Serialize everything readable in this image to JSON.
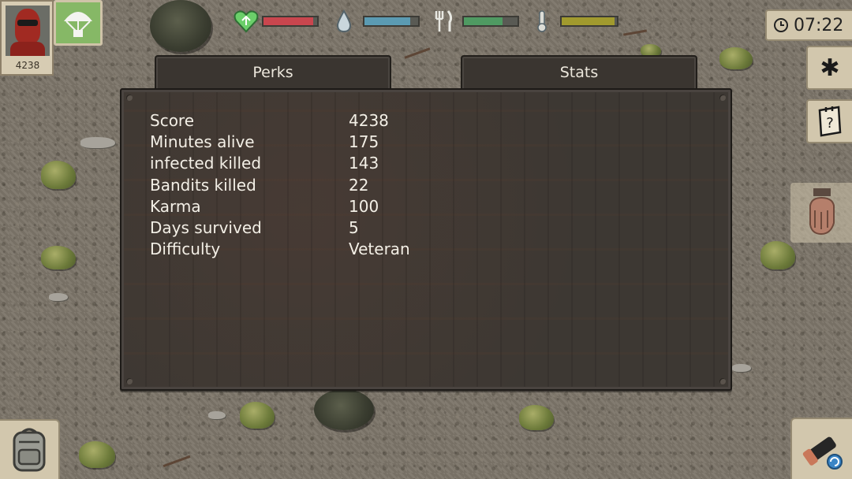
{
  "hud": {
    "player_score": "4238",
    "clock_time": "07:22",
    "portrait_icon": "player-avatar",
    "airdrop_icon": "parachute-icon",
    "bars": [
      {
        "name": "health",
        "icon": "heart-icon",
        "level": 0.92,
        "color": "#c9464e"
      },
      {
        "name": "thirst",
        "icon": "water-drop-icon",
        "level": 0.85,
        "color": "#5b9bb3"
      },
      {
        "name": "hunger",
        "icon": "fork-knife-icon",
        "level": 0.72,
        "color": "#4f9a62"
      },
      {
        "name": "temperature",
        "icon": "thermometer-icon",
        "level": 0.95,
        "color": "#a19a2e"
      }
    ]
  },
  "tabs": {
    "perks_label": "Perks",
    "stats_label": "Stats",
    "active": "Stats"
  },
  "stats": [
    {
      "label": "Score",
      "value": "4238"
    },
    {
      "label": "Minutes alive",
      "value": "175"
    },
    {
      "label": "infected killed",
      "value": "143"
    },
    {
      "label": "Bandits killed",
      "value": "22"
    },
    {
      "label": "Karma",
      "value": "100"
    },
    {
      "label": "Days survived",
      "value": "5"
    },
    {
      "label": "Difficulty",
      "value": "Veteran"
    }
  ],
  "side_buttons": {
    "settings_icon": "gear-icon",
    "quests_icon": "notes-icon",
    "hand_icon": "hand-icon",
    "backpack_icon": "backpack-icon",
    "weapon_icon": "flashlight-icon"
  }
}
